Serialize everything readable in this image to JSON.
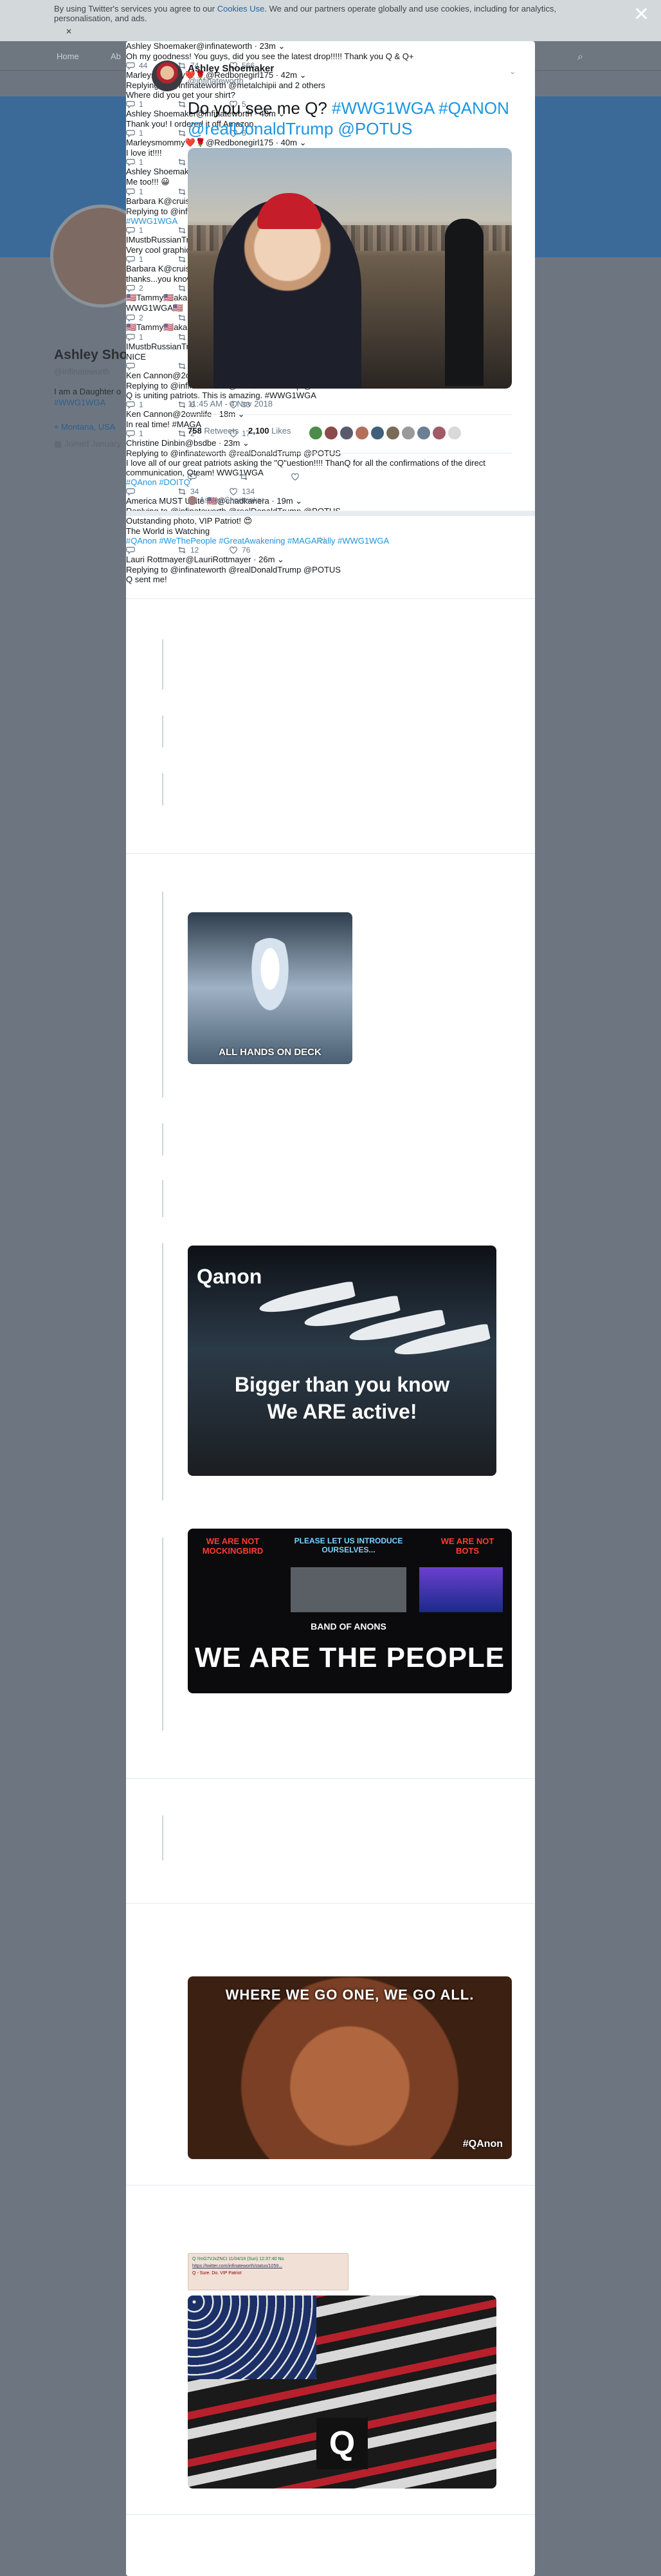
{
  "background": {
    "cookie_text": "By using Twitter's services you agree to our",
    "cookie_link": "Cookies Use",
    "cookie_text2": ". We and our partners operate globally and use cookies, including for analytics, personalisation, and ads.",
    "nav_home": "Home",
    "nav_about": "Ab",
    "profile_name": "Ashley Shoe",
    "profile_handle": "@infinateworth",
    "profile_bio1": "I am a Daughter o",
    "profile_bio2": "#WWG1WGA",
    "profile_location": "Montana, USA",
    "profile_joined": "Joined January",
    "right_label": " "
  },
  "main_tweet": {
    "name": "Ashley Shoemaker",
    "handle": "@infinateworth",
    "text_plain": "Do you see me Q? ",
    "text_tags": "#WWG1WGA #QANON @realDonaldTrump @POTUS",
    "time": "11:45 AM - 4 Nov 2018",
    "retweets_count": "758",
    "retweets_label": "Retweets",
    "likes_count": "2,100",
    "likes_label": "Likes",
    "recent_label": "Ashley Shoemaker"
  },
  "colors": {
    "link": "#1b95e0",
    "like": "#e0245e",
    "retweet": "#17bf63"
  },
  "replies": [
    {
      "name": "Ashley Shoemaker",
      "handle": "@infinateworth",
      "time": "23m",
      "text": "Oh my goodness! You guys, did you see the latest drop!!!!! Thank you Q & Q+",
      "reply": "44",
      "rt": "74",
      "like": "566"
    },
    {
      "name": "Marleysmommy❤️🌹",
      "handle": "@Redbonegirl175",
      "time": "42m",
      "replying": "Replying to",
      "reply_to": "@infinateworth",
      "reply_to2": "@metalchipii",
      "reply_others": "and 2 others",
      "text": "Where did you get your shirt?",
      "reply": "1",
      "rt": "",
      "like": "5"
    },
    {
      "name": "Ashley Shoemaker",
      "handle": "@infinateworth",
      "time": "40m",
      "text": "Thank you! I ordered it off Amazon.",
      "reply": "1",
      "rt": "",
      "like": "6"
    },
    {
      "name": "Marleysmommy❤️🌹",
      "handle": "@Redbonegirl175",
      "time": "40m",
      "text": "I love it!!!!",
      "reply": "1",
      "rt": "",
      "like": "3"
    },
    {
      "name": "Ashley Shoemaker",
      "handle": "@infinateworth",
      "time": "26m",
      "text": "Me too!!! 😀",
      "reply": "1",
      "rt": "",
      "like": "1"
    },
    {
      "name": "Barbara K",
      "handle": "@cruisesandiego",
      "time": "21m",
      "replying": "Replying to",
      "reply_to": "@infinateworth",
      "reply_to2": "@Christi37902766",
      "reply_others": "and 2 others",
      "text": "#WWG1WGA",
      "image_caption": "ALL HANDS ON DECK",
      "reply": "1",
      "rt": "12",
      "like": "39"
    },
    {
      "name": "IMustbRussianTricia",
      "handle": "@Ricca_19",
      "time": "11m",
      "text": "Very cool graphic",
      "reply": "1",
      "rt": "",
      "like": "4"
    },
    {
      "name": "Barbara K",
      "handle": "@cruisesandiego",
      "time": "9m",
      "text": "thanks...you know where I got it....if you are a Q follower!!!!!!",
      "reply": "2",
      "rt": "1",
      "like": "5"
    },
    {
      "name": "🇺🇸Tammy🇺🇸akaLilRed1",
      "handle": "@realTammyC",
      "time": "6m",
      "text": "WWG1WGA🇺🇸",
      "image_title": "Qanon",
      "image_line1": "Bigger than you know",
      "image_line2": "We ARE active!",
      "reply": "2",
      "rt": "3",
      "like": "5"
    },
    {
      "name": "🇺🇸Tammy🇺🇸akaLilRed1",
      "handle": "@realTammyC",
      "time": "3m",
      "text": "",
      "image_left": "WE ARE NOT MOCKINGBIRD",
      "image_mid": "PLEASE LET US INTRODUCE OURSELVES...",
      "image_right": "WE ARE NOT BOTS",
      "image_band": "BAND OF ANONS",
      "image_big": "WE ARE THE PEOPLE",
      "reply": "1",
      "rt": "2",
      "like": "4"
    },
    {
      "name": "IMustbRussianTricia",
      "handle": "@Ricca_19",
      "time": "60s",
      "text": "NICE",
      "reply": "",
      "rt": "",
      "like": ""
    },
    {
      "name": "Ken Cannon",
      "handle": "@2ownlife",
      "time": "23m",
      "replying": "Replying to",
      "reply_to": "@infinateworth",
      "reply_to2": "@realDonaldTrump",
      "reply_to3": "@POTUS",
      "text_plain": "Q is uniting patriots. This is amazing. ",
      "text_tag": "#WWG1WGA",
      "reply": "1",
      "rt": "6",
      "like": "33"
    },
    {
      "name": "Ken Cannon",
      "handle": "@2ownlife",
      "time": "18m",
      "text_plain": "In real time! ",
      "text_tag": "#MAGA",
      "reply": "1",
      "rt": "2",
      "like": "17"
    },
    {
      "name": "Christine Dinbin",
      "handle": "@bsdbe",
      "time": "23m",
      "replying": "Replying to",
      "reply_to": "@infinateworth",
      "reply_to2": "@realDonaldTrump",
      "reply_to3": "@POTUS",
      "text": "I love all of our great patriots asking the \"Q\"uestion!!!! ThanQ for all the confirmations of the direct communication, Qteam! WWG1WGA",
      "text_tags": "#QAnon #DOITQ",
      "image_headline": "WHERE WE GO ONE, WE GO ALL.",
      "image_tag": "#QAnon",
      "reply": "",
      "rt": "34",
      "like": "134"
    },
    {
      "name": "America MUST Unite 🇺🇸",
      "handle": "@chadkanera",
      "time": "19m",
      "replying": "Replying to",
      "reply_to": "@infinateworth",
      "reply_to2": "@realDonaldTrump",
      "reply_to3": "@POTUS",
      "text_l1": "Outstanding photo, VIP Patriot! 😍",
      "text_l2": "The World is Watching",
      "text_tags": "#QAnon #WeThePeople #GreatAwakening #MAGARally #WWG1WGA",
      "embed_l1": "Q !!mG7VJxZNCI  11/04/18 (Sun) 12:37:40 No.",
      "embed_l2": "https://twitter.com/infinateworth/status/1059...",
      "embed_l3": "Q - Sure. Do. VIP Patriot",
      "flag_letter": "Q",
      "reply": "",
      "rt": "12",
      "like": "76"
    },
    {
      "name": "Lauri Rottmayer",
      "handle": "@LauriRottmayer",
      "time": "26m",
      "replying": "Replying to",
      "reply_to": "@infinateworth",
      "reply_to2": "@realDonaldTrump",
      "reply_to3": "@POTUS",
      "text": "Q sent me!"
    }
  ]
}
